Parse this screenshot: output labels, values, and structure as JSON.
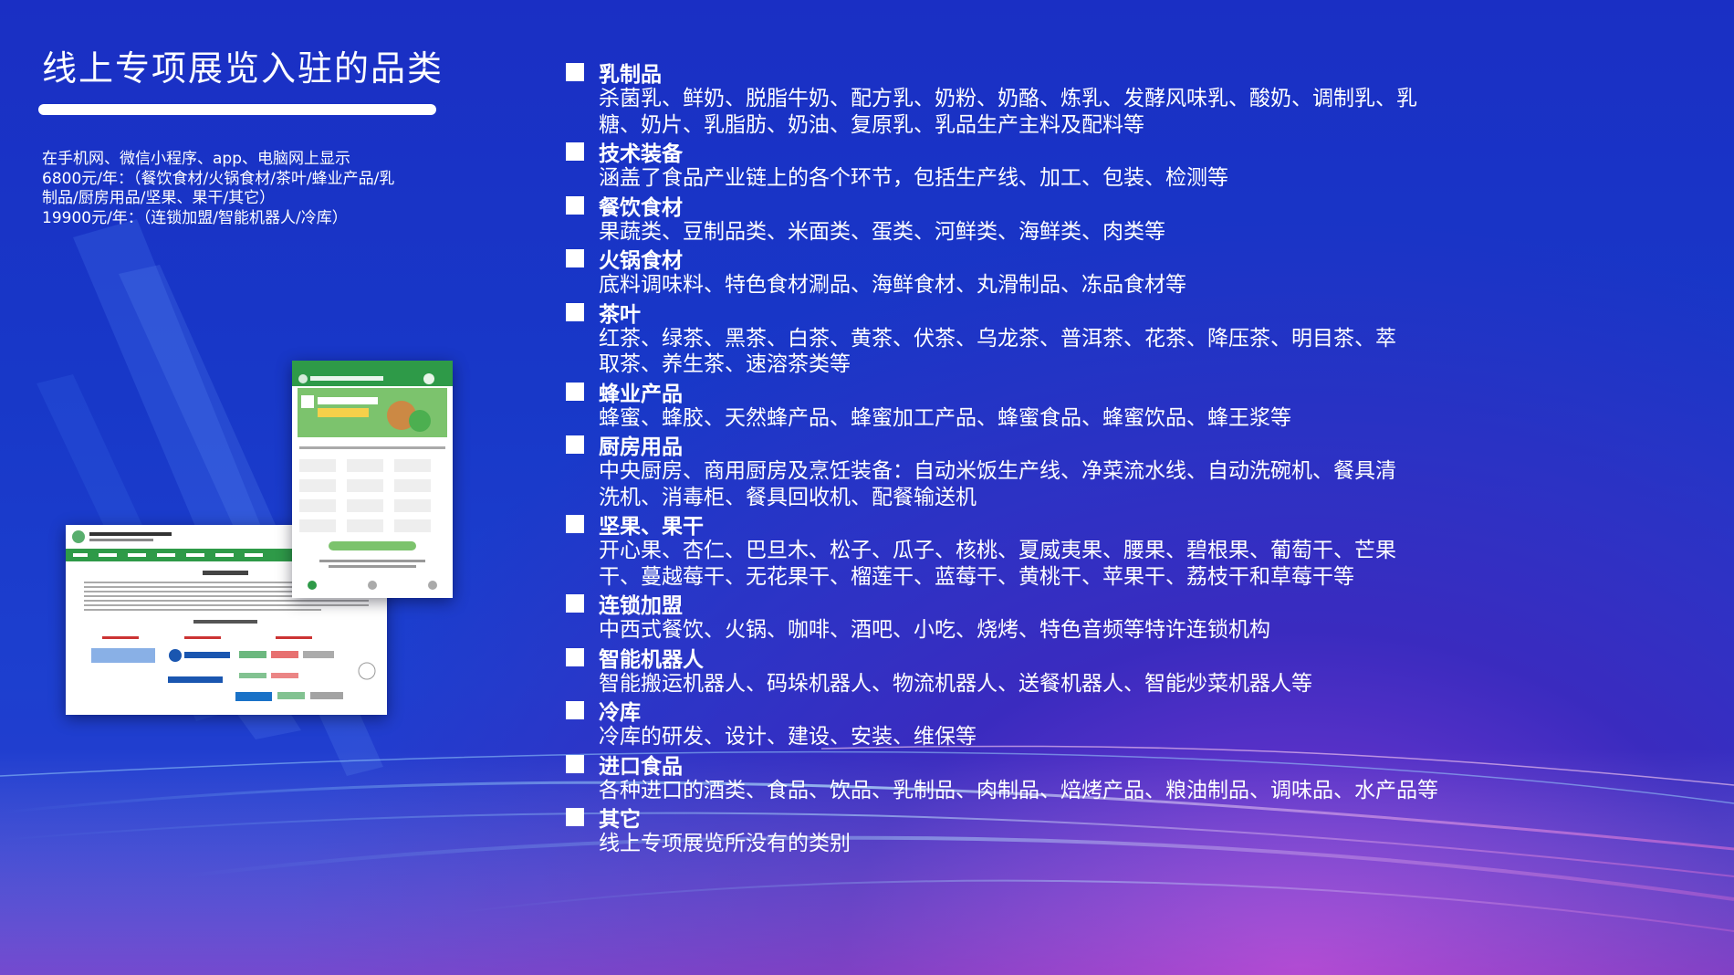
{
  "slide": {
    "title": "线上专项展览入驻的品类",
    "intro_lines": [
      "在手机网、微信小程序、app、电脑网上显示",
      "6800元/年：（餐饮食材/火锅食材/茶叶/蜂业产品/乳",
      "制品/厨房用品/坚果、果干/其它）",
      "19900元/年：（连锁加盟/智能机器人/冷库）"
    ]
  },
  "categories": [
    {
      "name": "乳制品",
      "desc": "杀菌乳、鲜奶、脱脂牛奶、配方乳、奶粉、奶酪、炼乳、发酵风味乳、酸奶、调制乳、乳\n糖、奶片、乳脂肪、奶油、复原乳、乳品生产主料及配料等"
    },
    {
      "name": "技术装备",
      "desc": "涵盖了食品产业链上的各个环节，包括生产线、加工、包装、检测等"
    },
    {
      "name": "餐饮食材",
      "desc": "果蔬类、豆制品类、米面类、蛋类、河鲜类、海鲜类、肉类等"
    },
    {
      "name": "火锅食材",
      "desc": "底料调味料、特色食材涮品、海鲜食材、丸滑制品、冻品食材等"
    },
    {
      "name": "茶叶",
      "desc": "红茶、绿茶、黑茶、白茶、黄茶、伏茶、乌龙茶、普洱茶、花茶、降压茶、明目茶、萃\n取茶、养生茶、速溶茶类等"
    },
    {
      "name": "蜂业产品",
      "desc": "蜂蜜、蜂胶、天然蜂产品、蜂蜜加工产品、蜂蜜食品、蜂蜜饮品、蜂王浆等"
    },
    {
      "name": "厨房用品",
      "desc": "中央厨房、商用厨房及烹饪装备：自动米饭生产线、净菜流水线、自动洗碗机、餐具清\n洗机、消毒柜、餐具回收机、配餐输送机"
    },
    {
      "name": "坚果、果干",
      "desc": "开心果、杏仁、巴旦木、松子、瓜子、核桃、夏威夷果、腰果、碧根果、葡萄干、芒果\n干、蔓越莓干、无花果干、榴莲干、蓝莓干、黄桃干、苹果干、荔枝干和草莓干等"
    },
    {
      "name": "连锁加盟",
      "desc": "中西式餐饮、火锅、咖啡、酒吧、小吃、烧烤、特色音频等特许连锁机构"
    },
    {
      "name": "智能机器人",
      "desc": "智能搬运机器人、码垛机器人、物流机器人、送餐机器人、智能炒菜机器人等"
    },
    {
      "name": "冷库",
      "desc": "冷库的研发、设计、建设、安装、维保等"
    },
    {
      "name": "进口食品",
      "desc": "各种进口的酒类、食品、饮品、乳制品、肉制品、焙烤产品、粮油制品、调味品、水产品等"
    },
    {
      "name": "其它",
      "desc": "线上专项展览所没有的类别"
    }
  ],
  "colors": {
    "background": "#1a33c6",
    "text": "#ffffff",
    "accent_green": "#2e9a48"
  }
}
